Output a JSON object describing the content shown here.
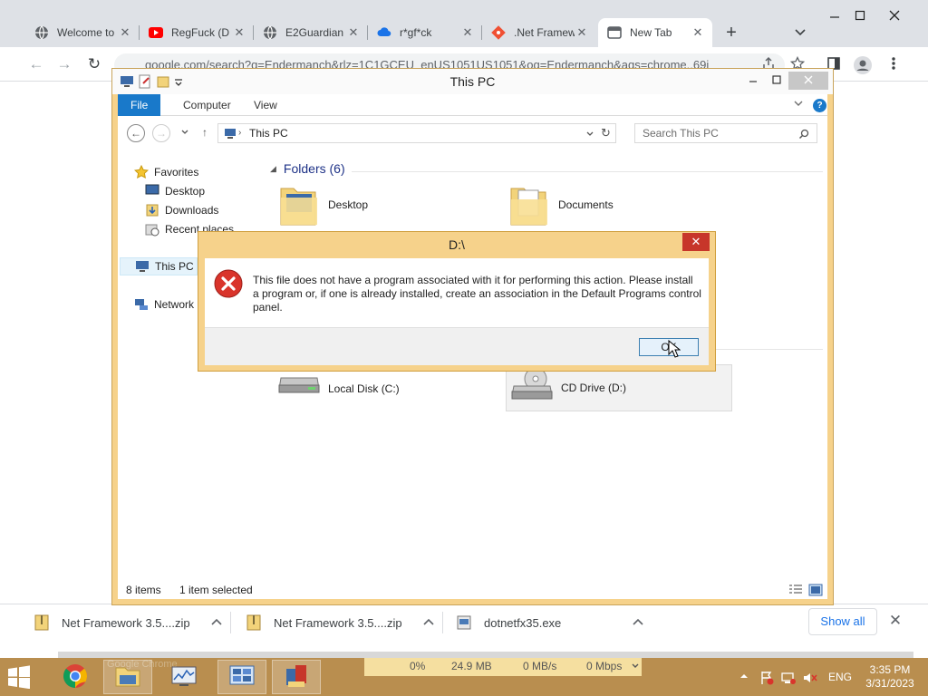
{
  "chrome": {
    "tabs": [
      {
        "label": "Welcome to",
        "icon": "globe-icon"
      },
      {
        "label": "RegFuck (D",
        "icon": "youtube-icon"
      },
      {
        "label": "E2Guardian",
        "icon": "globe-icon"
      },
      {
        "label": "r*gf*ck",
        "icon": "cloud-icon"
      },
      {
        "label": ".Net Framew",
        "icon": "git-icon"
      },
      {
        "label": "New Tab",
        "icon": "newtab-icon",
        "active": true
      }
    ],
    "address": "google.com/search?q=Endermanch&rlz=1C1GCEU_enUS1051US1051&oq=Endermanch&aqs=chrome..69i",
    "downloads": [
      {
        "name": "Net Framework 3.5....zip",
        "icon": "zip-icon"
      },
      {
        "name": "Net Framework 3.5....zip",
        "icon": "zip-icon"
      },
      {
        "name": "dotnetfx35.exe",
        "icon": "exe-icon"
      }
    ],
    "show_all_label": "Show all"
  },
  "explorer": {
    "title": "This PC",
    "ribbon_tabs": [
      "File",
      "Computer",
      "View"
    ],
    "address": "This PC",
    "search_placeholder": "Search This PC",
    "nav": {
      "favorites": "Favorites",
      "desktop": "Desktop",
      "downloads": "Downloads",
      "recent": "Recent places",
      "this_pc": "This PC",
      "network": "Network"
    },
    "folders_heading": "Folders (6)",
    "folders": [
      {
        "name": "Desktop",
        "icon": "folder-desktop-icon"
      },
      {
        "name": "Documents",
        "icon": "folder-documents-icon"
      }
    ],
    "drives": [
      {
        "name": "Local Disk (C:)",
        "icon": "hard-disk-icon"
      },
      {
        "name": "CD Drive (D:)",
        "icon": "cd-drive-icon",
        "selected": true
      }
    ],
    "status": {
      "items": "8 items",
      "selected": "1 item selected"
    }
  },
  "dialog": {
    "title": "D:\\",
    "message": "This file does not have a program associated with it for performing this action. Please install a program or, if one is already installed, create an association in the Default Programs control panel.",
    "ok_label": "OK"
  },
  "taskbar": {
    "ghost_label": "Google Chrome",
    "meter": {
      "cpu": "0%",
      "memory": "24.9 MB",
      "disk": "0 MB/s",
      "network": "0 Mbps"
    },
    "language": "ENG",
    "time": "3:35 PM",
    "date": "3/31/2023"
  },
  "colors": {
    "accent": "#1979ca",
    "taskbar": "#b98e4f",
    "window_frame": "#f6d28b",
    "error": "#c7362a"
  }
}
